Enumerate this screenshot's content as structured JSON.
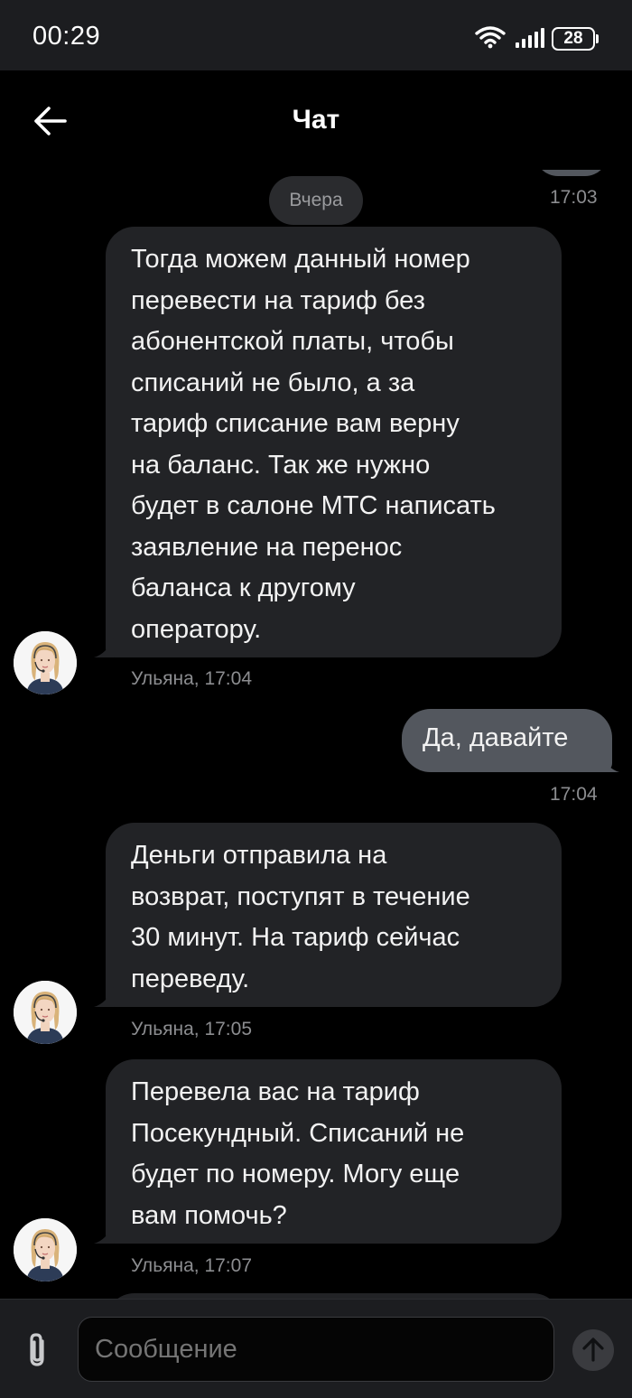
{
  "status_bar": {
    "time": "00:29",
    "battery": "28",
    "icons": [
      "wifi-icon",
      "signal-icon",
      "battery-icon"
    ]
  },
  "header": {
    "title": "Чат",
    "back_icon": "arrow-left-icon"
  },
  "chat": {
    "date_divider": "Вчера",
    "prev_message_time": "17:03",
    "messages": [
      {
        "direction": "in",
        "lines": [
          "Тогда можем данный номер",
          "перевести на тариф без",
          "абонентской платы, чтобы",
          "списаний не было, а за",
          "тариф списание вам верну",
          "на баланс. Так же нужно",
          "будет в салоне МТС написать",
          "заявление на перенос",
          "баланса к другому",
          "оператору."
        ],
        "meta": "Ульяна, 17:04"
      },
      {
        "direction": "out",
        "lines": [
          "Да, давайте"
        ],
        "meta": "17:04"
      },
      {
        "direction": "in",
        "lines": [
          "Деньги отправила на",
          "возврат, поступят в течение",
          "30 минут. На тариф сейчас",
          "переведу."
        ],
        "meta": "Ульяна, 17:05"
      },
      {
        "direction": "in",
        "lines": [
          "Перевела вас на тариф",
          "Посекундный. Списаний не",
          "будет по номеру. Могу еще",
          "вам помочь?"
        ],
        "meta": "Ульяна, 17:07"
      }
    ]
  },
  "composer": {
    "placeholder": "Сообщение",
    "attach_icon": "paperclip-icon",
    "send_icon": "arrow-up-icon"
  },
  "colors": {
    "background": "#000000",
    "incoming_bubble": "#222326",
    "outgoing_bubble": "#53575e",
    "meta_text": "#8c8d90",
    "bars": "#1c1d20"
  }
}
